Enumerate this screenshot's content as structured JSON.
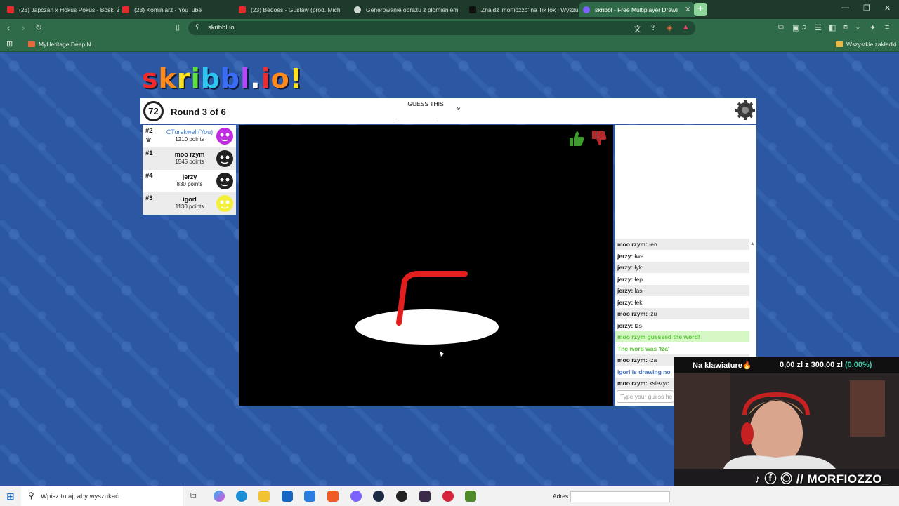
{
  "browser": {
    "tabs": [
      {
        "title": "(23) Japczan x Hokus Pokus - Boski Ż",
        "favicon_color": "#e22b2b"
      },
      {
        "title": "(23) Kominiarz - YouTube",
        "favicon_color": "#e22b2b"
      },
      {
        "title": "(23) Bedoes - Gustaw (prod. Mich",
        "favicon_color": "#e22b2b"
      },
      {
        "title": "Generowanie obrazu z płomieniem",
        "favicon_color": "#cfd8d3"
      },
      {
        "title": "Znajdź 'morfiozzo' na TikTok | Wyszu",
        "favicon_color": "#111111"
      },
      {
        "title": "skribbl - Free Multiplayer Drawin",
        "favicon_color": "#7b61ff"
      }
    ],
    "new_tab_label": "+",
    "url": "skribbl.io",
    "bookmarks": [
      {
        "label": "MyHeritage Deep N..."
      },
      {
        "label": "Wszystkie zakładki"
      }
    ]
  },
  "game": {
    "logo_letters": [
      "s",
      "k",
      "r",
      "i",
      "b",
      "b",
      "l",
      ".",
      "i",
      "o",
      "!"
    ],
    "logo_colors": [
      "#ef2b2b",
      "#ff8a1c",
      "#ffe11f",
      "#5fe236",
      "#2ec4f0",
      "#3b6cf5",
      "#b34bf5",
      "#ffffff",
      "#ef2b2b",
      "#ff8a1c",
      "#ffe11f"
    ],
    "timer": "72",
    "round": "Round 3 of 6",
    "guess_label": "GUESS THIS",
    "word_hint": "_________",
    "word_length": "9",
    "players": [
      {
        "rank": "#2",
        "name": "CTurekwel (You)",
        "points": "1210 points",
        "me": true,
        "avatar_color": "#c02ce0"
      },
      {
        "rank": "#1",
        "name": "moo rzym",
        "points": "1545 points",
        "me": false,
        "avatar_color": "#222222"
      },
      {
        "rank": "#4",
        "name": "jerzy",
        "points": "830 points",
        "me": false,
        "avatar_color": "#222222"
      },
      {
        "rank": "#3",
        "name": "igorl",
        "points": "1130 points",
        "me": false,
        "avatar_color": "#f4f03a"
      }
    ],
    "chat": [
      {
        "user": "moo rzym",
        "text": "łen",
        "type": "normal"
      },
      {
        "user": "jerzy",
        "text": "łwe",
        "type": "normal"
      },
      {
        "user": "jerzy",
        "text": "łyk",
        "type": "normal"
      },
      {
        "user": "jerzy",
        "text": "łep",
        "type": "normal"
      },
      {
        "user": "jerzy",
        "text": "łas",
        "type": "normal"
      },
      {
        "user": "jerzy",
        "text": "łek",
        "type": "normal"
      },
      {
        "user": "moo rzym",
        "text": "łzu",
        "type": "normal"
      },
      {
        "user": "jerzy",
        "text": "łzs",
        "type": "normal"
      },
      {
        "user": "",
        "text": "moo rzym guessed the word!",
        "type": "guessed"
      },
      {
        "user": "",
        "text": "The word was 'łza'",
        "type": "word"
      },
      {
        "user": "moo rzym",
        "text": "łza",
        "type": "normal"
      },
      {
        "user": "",
        "text": "igorl is drawing no",
        "type": "drawing"
      },
      {
        "user": "moo rzym",
        "text": "ksiezyc",
        "type": "normal"
      }
    ],
    "chat_placeholder": "Type your guess he"
  },
  "overlay": {
    "typing_label": "Na klawiature🔥",
    "donation_prefix": "0,00 zł z 300,00 zł",
    "donation_pct": "(0.00%)",
    "handle": "♪ ⓕ ◎ // MORFIOZZO_"
  },
  "taskbar": {
    "search_placeholder": "Wpisz tutaj, aby wyszukać",
    "address_label": "Adres"
  }
}
